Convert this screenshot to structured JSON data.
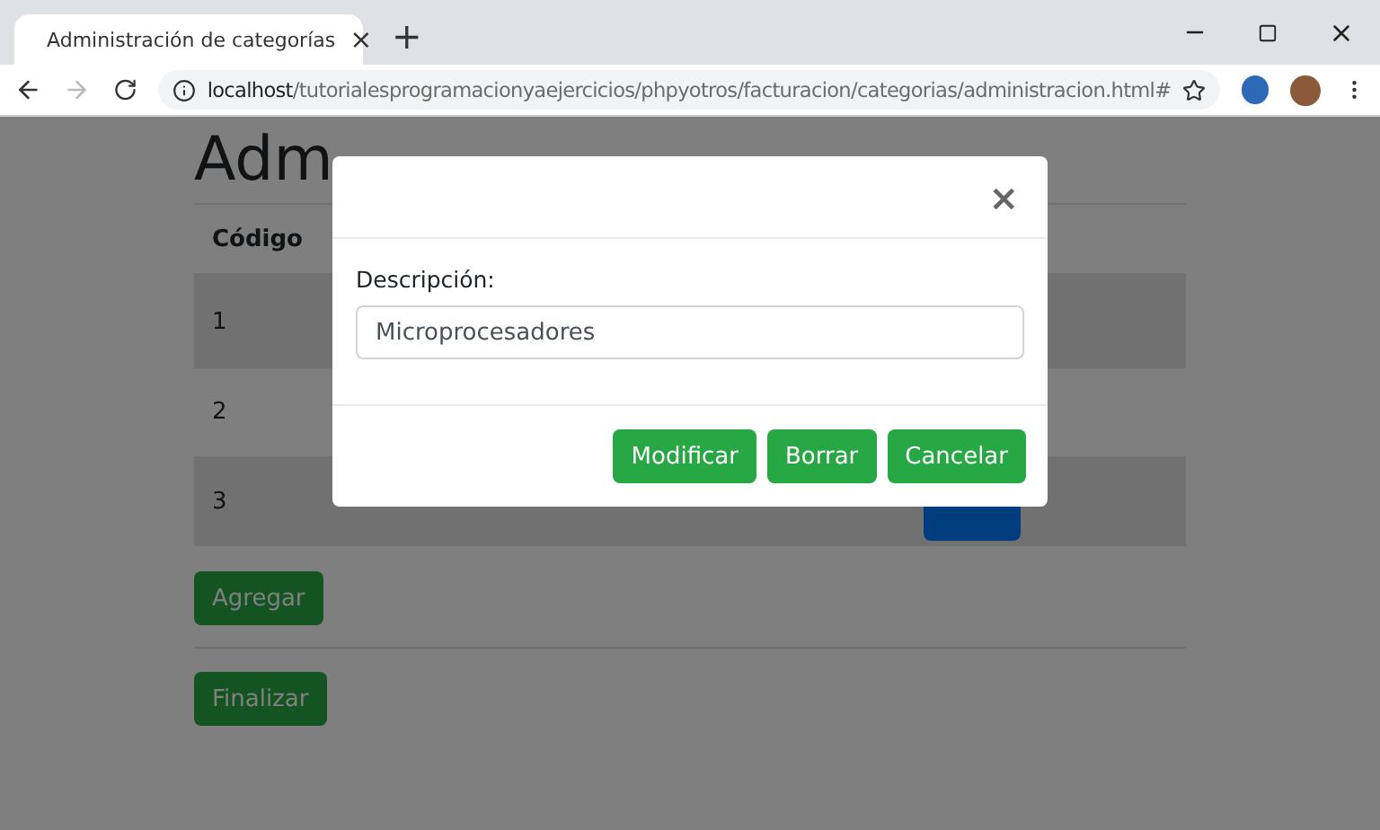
{
  "browser": {
    "tab": {
      "title": "Administración de categorías",
      "close": "×"
    },
    "new_tab": "+",
    "forward_disabled": true,
    "address": {
      "host": "localhost",
      "path": "/tutorialesprogramacionyaejercicios/phpyotros/facturacion/categorias/administracion.html#"
    }
  },
  "page": {
    "title": "Adm",
    "table": {
      "columns": [
        "Código"
      ],
      "rows": [
        {
          "code": "1",
          "striped": true
        },
        {
          "code": "2",
          "striped": false
        },
        {
          "code": "3",
          "striped": true,
          "has_button": true
        }
      ]
    },
    "buttons": [
      "Agregar",
      "Finalizar"
    ]
  },
  "modal": {
    "close": "×",
    "label": "Descripción:",
    "value": "Microprocesadores",
    "buttons": [
      "Modificar",
      "Borrar",
      "Cancelar"
    ]
  }
}
